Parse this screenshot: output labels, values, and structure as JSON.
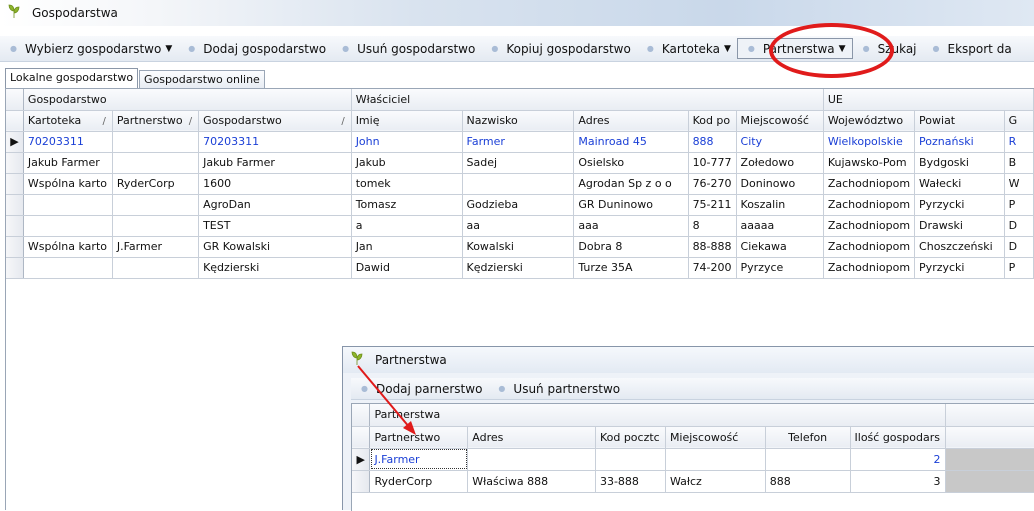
{
  "window": {
    "title": "Gospodarstwa",
    "app_icon": "leaf-icon"
  },
  "toolbar": {
    "items": [
      {
        "label": "Wybierz gospodarstwo",
        "has_dropdown": true
      },
      {
        "label": "Dodaj gospodarstwo",
        "has_dropdown": false
      },
      {
        "label": "Usuń gospodarstwo",
        "has_dropdown": false
      },
      {
        "label": "Kopiuj gospodarstwo",
        "has_dropdown": false
      },
      {
        "label": "Kartoteka",
        "has_dropdown": true
      },
      {
        "label": "Partnerstwa",
        "has_dropdown": true,
        "pressed": true,
        "highlighted": true
      },
      {
        "label": "Szukaj",
        "has_dropdown": false
      },
      {
        "label": "Eksport da",
        "has_dropdown": false
      }
    ]
  },
  "tabs": [
    {
      "label": "Lokalne gospodarstwo",
      "active": true
    },
    {
      "label": "Gospodarstwo online",
      "active": false
    }
  ],
  "grid": {
    "bands": [
      {
        "label": "Gospodarstwo"
      },
      {
        "label": "Właściciel"
      },
      {
        "label": "UE"
      }
    ],
    "columns": [
      {
        "label": "Kartoteka",
        "sort": "/"
      },
      {
        "label": "Partnerstwo",
        "sort": "/"
      },
      {
        "label": "Gospodarstwo",
        "sort": "/"
      },
      {
        "label": "Imię"
      },
      {
        "label": "Nazwisko"
      },
      {
        "label": "Adres"
      },
      {
        "label": "Kod po"
      },
      {
        "label": "Miejscowość"
      },
      {
        "label": "Województwo"
      },
      {
        "label": "Powiat"
      },
      {
        "label": "G"
      }
    ],
    "rows": [
      {
        "current": true,
        "cells": [
          "70203311",
          "",
          "70203311",
          "John",
          "Farmer",
          "Mainroad 45",
          "888",
          "City",
          "Wielkopolskie",
          "Poznański",
          "R"
        ]
      },
      {
        "current": false,
        "cells": [
          "Jakub Farmer",
          "",
          "Jakub Farmer",
          "Jakub",
          "Sadej",
          "Osielsko",
          "10-777",
          "Zołedowo",
          "Kujawsko-Pom",
          "Bydgoski",
          "B"
        ]
      },
      {
        "current": false,
        "cells": [
          "Wspólna karto",
          "RyderCorp",
          "1600",
          "tomek",
          "",
          "Agrodan Sp z o o",
          "76-270",
          "Doninowo",
          "Zachodniopom",
          "Wałecki",
          "W"
        ]
      },
      {
        "current": false,
        "cells": [
          "",
          "",
          "AgroDan",
          "Tomasz",
          "Godzieba",
          "GR Duninowo",
          "75-211",
          "Koszalin",
          "Zachodniopom",
          "Pyrzycki",
          "P"
        ]
      },
      {
        "current": false,
        "cells": [
          "",
          "",
          "TEST",
          "a",
          "aa",
          "aaa",
          "8",
          "aaaaa",
          "Zachodniopom",
          "Drawski",
          "D"
        ]
      },
      {
        "current": false,
        "cells": [
          "Wspólna karto",
          "J.Farmer",
          "GR Kowalski",
          "Jan",
          "Kowalski",
          "Dobra 8",
          "88-888",
          "Ciekawa",
          "Zachodniopom",
          "Choszczeński",
          "D"
        ]
      },
      {
        "current": false,
        "cells": [
          "",
          "",
          "Kędzierski",
          "Dawid",
          "Kędzierski",
          "Turze 35A",
          "74-200",
          "Pyrzyce",
          "Zachodniopom",
          "Pyrzycki",
          "P"
        ]
      }
    ]
  },
  "popup": {
    "title": "Partnerstwa",
    "toolbar": [
      {
        "label": "Dodaj parnerstwo"
      },
      {
        "label": "Usuń partnerstwo"
      }
    ],
    "band": "Partnerstwa",
    "columns": [
      "Partnerstwo",
      "Adres",
      "Kod pocztc",
      "Miejscowość",
      "Telefon",
      "Ilość gospodars"
    ],
    "rows": [
      {
        "current": true,
        "cells": [
          "J.Farmer",
          "",
          "",
          "",
          "",
          "2"
        ]
      },
      {
        "current": false,
        "cells": [
          "RyderCorp",
          "Właściwa 888",
          "33-888",
          "Wałcz",
          "888",
          "3"
        ]
      }
    ]
  },
  "annotations": {
    "highlight_color": "#e01b1b"
  }
}
